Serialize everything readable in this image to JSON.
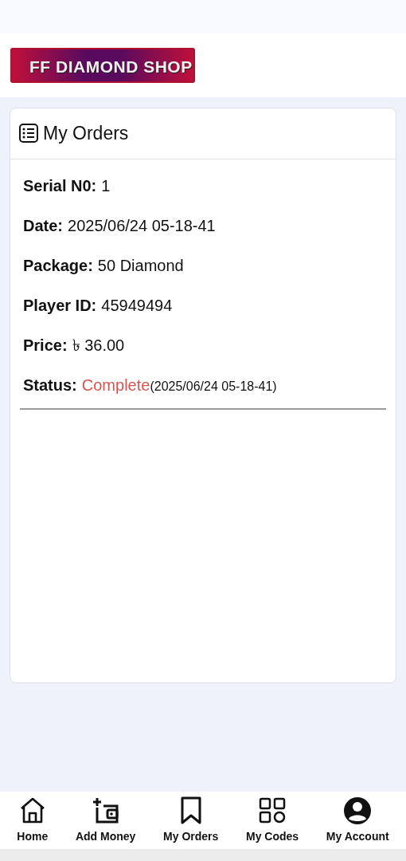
{
  "logo": {
    "text": "FF DIAMOND SHOP"
  },
  "orders_card": {
    "title": "My Orders",
    "fields": [
      {
        "kind": "text",
        "label": "Serial N0:",
        "value": "1"
      },
      {
        "kind": "text",
        "label": "Date:",
        "value": "2025/06/24 05-18-41"
      },
      {
        "kind": "text",
        "label": "Package:",
        "value": "50 Diamond"
      },
      {
        "kind": "text",
        "label": "Player ID:",
        "value": "45949494"
      },
      {
        "kind": "text",
        "label": "Price:",
        "value": "৳ 36.00"
      },
      {
        "kind": "status",
        "label": "Status:",
        "value": "Complete",
        "note": "(2025/06/24 05-18-41)"
      }
    ]
  },
  "bottom_nav": [
    {
      "kind": "home",
      "label": "Home"
    },
    {
      "kind": "wallet",
      "label": "Add Money"
    },
    {
      "kind": "bookmark",
      "label": "My Orders"
    },
    {
      "kind": "grid",
      "label": "My Codes"
    },
    {
      "kind": "account",
      "label": "My Account"
    }
  ]
}
